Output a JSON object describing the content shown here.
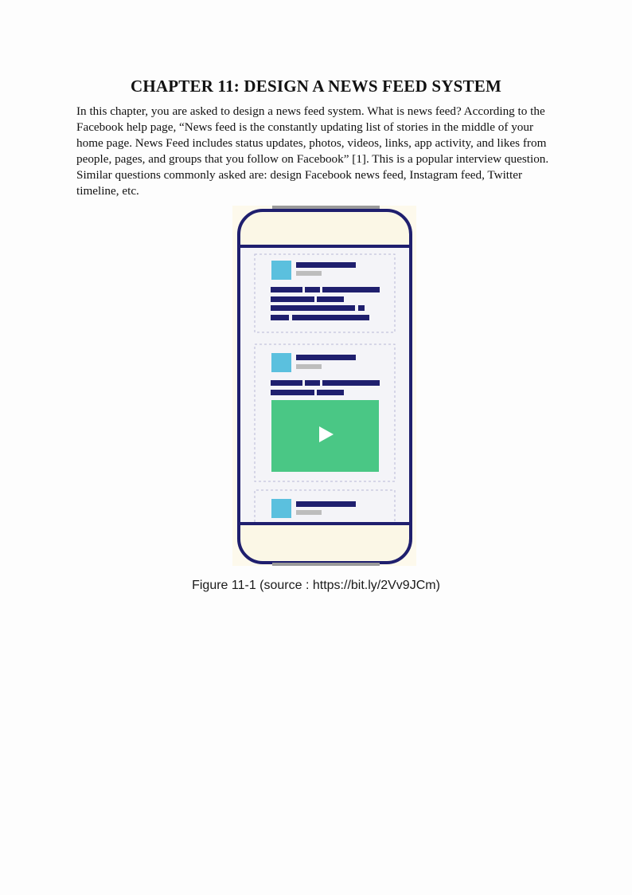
{
  "chapter": {
    "title": "CHAPTER 11: DESIGN A NEWS FEED SYSTEM",
    "paragraph": "In this chapter, you are asked to design a news feed system. What is news feed? According to the Facebook help page, “News feed is the constantly updating list of stories in the middle of your home page. News Feed includes status updates, photos, videos, links, app activity, and likes from people, pages, and groups that you follow on Facebook” [1]. This is a popular interview question. Similar questions commonly asked are: design Facebook news feed, Instagram feed, Twitter timeline, etc."
  },
  "figure": {
    "caption": "Figure 11-1 (source : https://bit.ly/2Vv9JCm)",
    "colors": {
      "frame": "#1f1f6e",
      "screen": "#f4f4f8",
      "bezel": "#fbf7e6",
      "avatar": "#5bc0de",
      "text_line": "#1f1f6e",
      "meta_line": "#bdbdbd",
      "video": "#4ac785",
      "card_border": "#b9b9d6"
    },
    "icons": [
      "play-icon"
    ]
  }
}
